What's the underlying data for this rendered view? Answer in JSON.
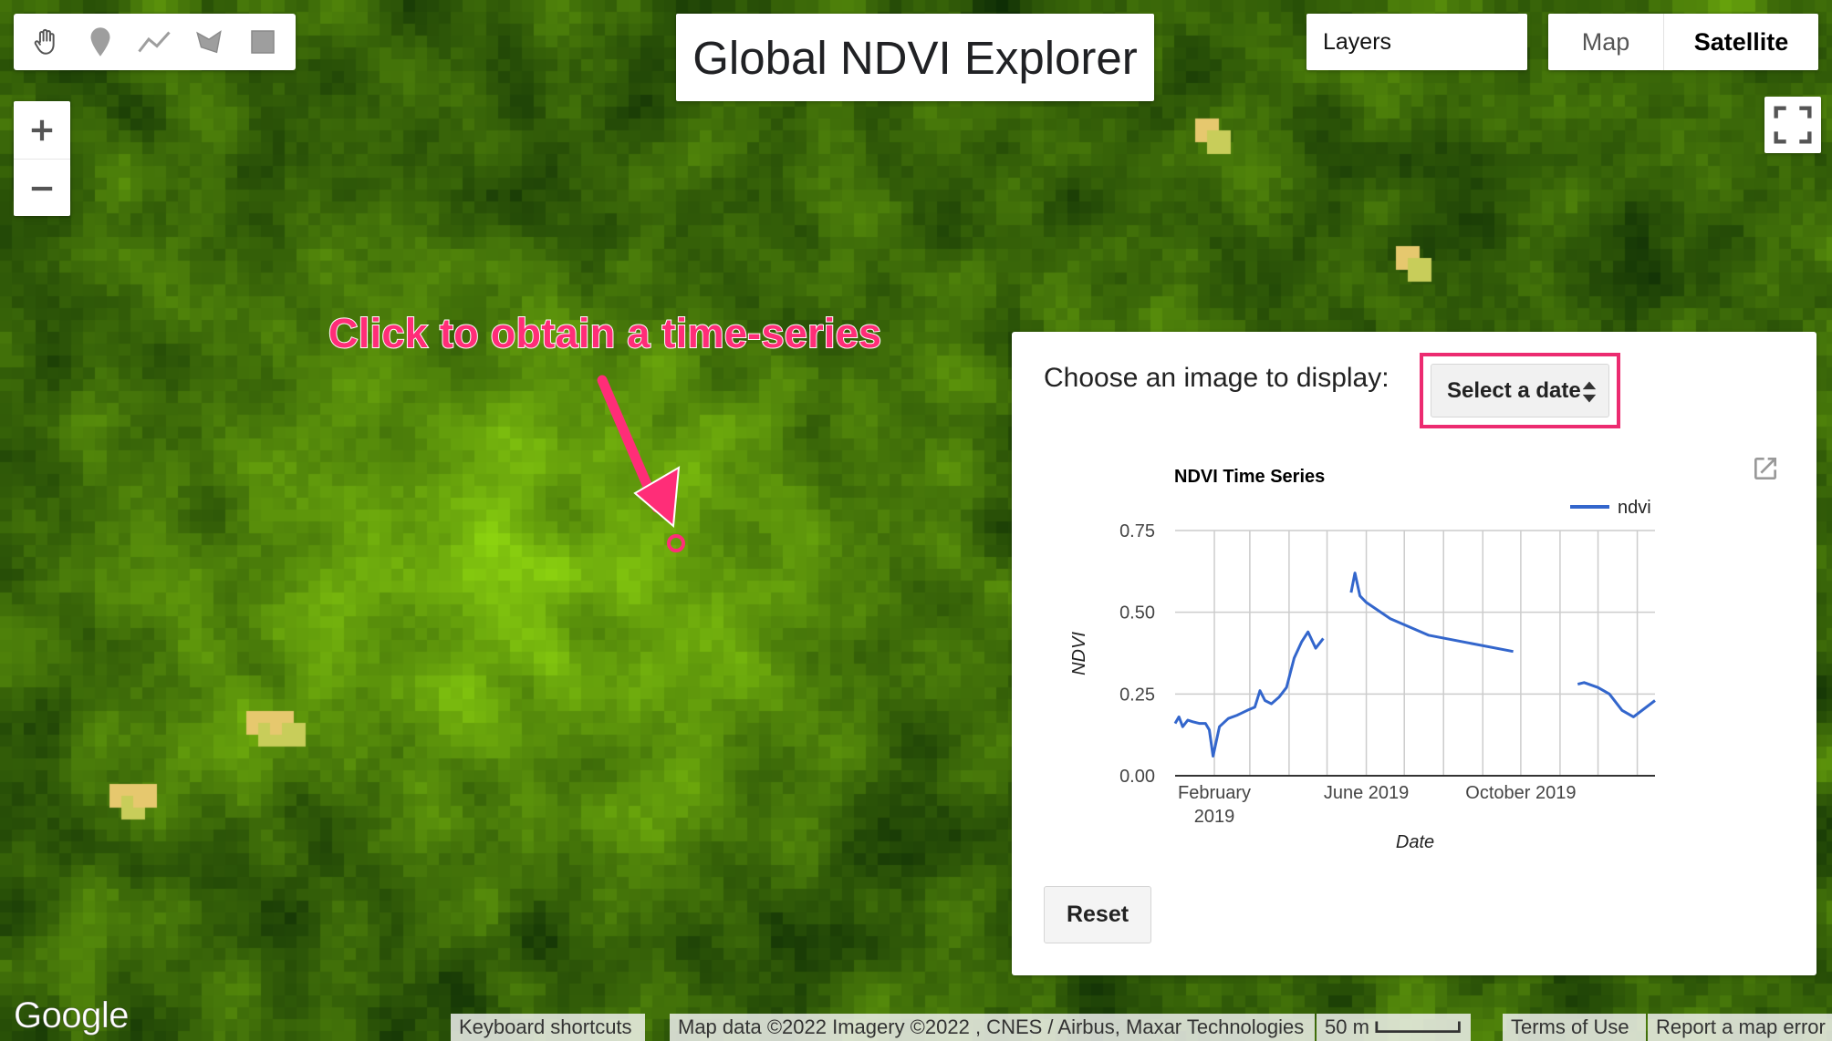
{
  "app": {
    "title": "Global NDVI Explorer"
  },
  "toolbar": {
    "tools": [
      {
        "name": "hand-tool",
        "icon": "hand-icon"
      },
      {
        "name": "point-tool",
        "icon": "map-pin-icon"
      },
      {
        "name": "line-tool",
        "icon": "polyline-icon"
      },
      {
        "name": "polygon-tool",
        "icon": "polygon-icon"
      },
      {
        "name": "rectangle-tool",
        "icon": "rectangle-icon"
      }
    ]
  },
  "layers": {
    "label": "Layers"
  },
  "map_type": {
    "options": [
      "Map",
      "Satellite"
    ],
    "selected": "Satellite"
  },
  "zoom": {
    "in_label": "+",
    "out_label": "−"
  },
  "annotation": {
    "text": "Click to obtain a time-series",
    "color": "#ff2d78"
  },
  "panel": {
    "choose_label": "Choose an image to display:",
    "date_select_value": "Select a date",
    "highlight_color": "#ec2b70",
    "reset_label": "Reset"
  },
  "chart_data": {
    "type": "line",
    "title": "NDVI Time Series",
    "xlabel": "Date",
    "ylabel": "NDVI",
    "ylim": [
      0,
      0.75
    ],
    "yticks": [
      "0.00",
      "0.25",
      "0.50",
      "0.75"
    ],
    "xticks": [
      {
        "date": "2019-02-01",
        "label": [
          "February",
          "2019"
        ]
      },
      {
        "date": "2019-06-01",
        "label": [
          "June 2019"
        ]
      },
      {
        "date": "2019-10-01",
        "label": [
          "October 2019"
        ]
      }
    ],
    "xlim": [
      "2019-01-01",
      "2020-01-15"
    ],
    "grid": true,
    "legend": "top-right",
    "series": [
      {
        "name": "ndvi",
        "color": "#3366cc",
        "segments": [
          [
            [
              "2019-01-01",
              0.16
            ],
            [
              "2019-01-04",
              0.18
            ],
            [
              "2019-01-07",
              0.15
            ],
            [
              "2019-01-11",
              0.17
            ],
            [
              "2019-01-15",
              0.165
            ],
            [
              "2019-01-20",
              0.16
            ],
            [
              "2019-01-25",
              0.16
            ],
            [
              "2019-01-28",
              0.14
            ],
            [
              "2019-01-31",
              0.06
            ],
            [
              "2019-02-05",
              0.15
            ],
            [
              "2019-02-12",
              0.175
            ],
            [
              "2019-02-19",
              0.185
            ],
            [
              "2019-02-27",
              0.2
            ],
            [
              "2019-03-05",
              0.21
            ],
            [
              "2019-03-09",
              0.26
            ],
            [
              "2019-03-13",
              0.23
            ],
            [
              "2019-03-18",
              0.22
            ],
            [
              "2019-03-24",
              0.24
            ],
            [
              "2019-03-30",
              0.27
            ],
            [
              "2019-04-05",
              0.36
            ],
            [
              "2019-04-11",
              0.41
            ],
            [
              "2019-04-16",
              0.44
            ],
            [
              "2019-04-22",
              0.39
            ],
            [
              "2019-04-28",
              0.42
            ]
          ],
          [
            [
              "2019-05-20",
              0.56
            ],
            [
              "2019-05-23",
              0.62
            ],
            [
              "2019-05-27",
              0.55
            ],
            [
              "2019-06-01",
              0.53
            ],
            [
              "2019-06-20",
              0.48
            ],
            [
              "2019-07-20",
              0.43
            ],
            [
              "2019-09-25",
              0.38
            ]
          ],
          [
            [
              "2019-11-15",
              0.28
            ],
            [
              "2019-11-20",
              0.285
            ],
            [
              "2019-12-01",
              0.27
            ],
            [
              "2019-12-10",
              0.25
            ],
            [
              "2019-12-20",
              0.2
            ],
            [
              "2019-12-29",
              0.18
            ],
            [
              "2020-01-15",
              0.23
            ]
          ]
        ]
      }
    ]
  },
  "footer": {
    "logo": "Google",
    "keyboard_shortcuts": "Keyboard shortcuts",
    "attribution": "Map data ©2022 Imagery ©2022 , CNES / Airbus, Maxar Technologies",
    "scale_label": "50 m",
    "terms": "Terms of Use",
    "report": "Report a map error"
  }
}
